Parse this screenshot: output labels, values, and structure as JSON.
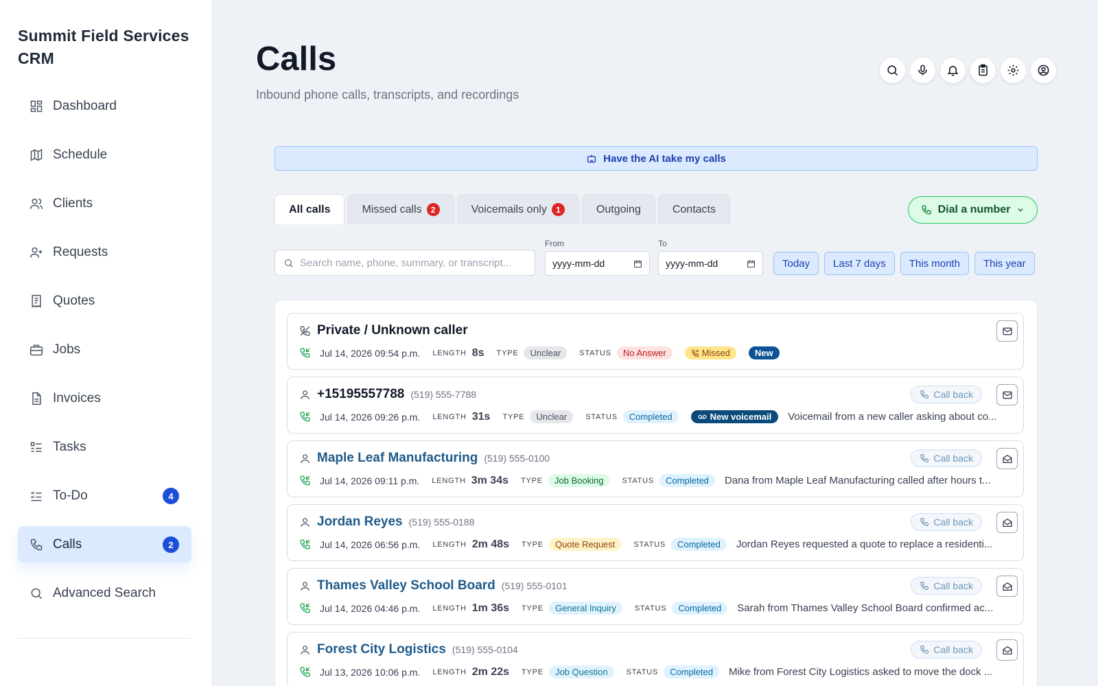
{
  "app": {
    "brand": "Summit Field Services CRM"
  },
  "sidebar": {
    "items": [
      {
        "label": "Dashboard",
        "icon": "dashboard-icon"
      },
      {
        "label": "Schedule",
        "icon": "map-icon"
      },
      {
        "label": "Clients",
        "icon": "users-icon"
      },
      {
        "label": "Requests",
        "icon": "user-plus-icon"
      },
      {
        "label": "Quotes",
        "icon": "receipt-icon"
      },
      {
        "label": "Jobs",
        "icon": "briefcase-icon"
      },
      {
        "label": "Invoices",
        "icon": "file-icon"
      },
      {
        "label": "Tasks",
        "icon": "tasks-icon"
      },
      {
        "label": "To-Do",
        "icon": "checklist-icon",
        "count": "4"
      },
      {
        "label": "Calls",
        "icon": "phone-icon",
        "count": "2",
        "active": true
      },
      {
        "label": "Advanced Search",
        "icon": "search-icon"
      }
    ]
  },
  "header": {
    "title": "Calls",
    "subtitle": "Inbound phone calls, transcripts, and recordings",
    "icons": [
      "search-icon",
      "microphone-icon",
      "bell-icon",
      "clipboard-icon",
      "gear-icon",
      "user-circle-icon"
    ]
  },
  "ai_banner": {
    "label": "Have the AI take my calls"
  },
  "tabs": [
    {
      "label": "All calls",
      "active": true
    },
    {
      "label": "Missed calls",
      "badge": "2"
    },
    {
      "label": "Voicemails only",
      "badge": "1"
    },
    {
      "label": "Outgoing"
    },
    {
      "label": "Contacts"
    }
  ],
  "dial": {
    "label": "Dial a number"
  },
  "filters": {
    "search_placeholder": "Search name, phone, summary, or transcript...",
    "from_label": "From",
    "to_label": "To",
    "date_placeholder": "yyyy-mm-dd",
    "ranges": [
      "Today",
      "Last 7 days",
      "This month",
      "This year"
    ]
  },
  "labels": {
    "length": "LENGTH",
    "type": "TYPE",
    "status": "STATUS",
    "call_back": "Call back"
  },
  "calls": [
    {
      "name": "Private / Unknown caller",
      "phone": "",
      "date": "Jul 14, 2026 09:54 p.m.",
      "length": "8s",
      "type": "Unclear",
      "status": "No Answer",
      "missed_flag": "Missed",
      "new_flag": "New",
      "summary": ""
    },
    {
      "name": "+15195557788",
      "phone": "(519) 555-7788",
      "date": "Jul 14, 2026 09:26 p.m.",
      "length": "31s",
      "type": "Unclear",
      "status": "Completed",
      "voicemail_flag": "New voicemail",
      "summary": "Voicemail from a new caller asking about co..."
    },
    {
      "name": "Maple Leaf Manufacturing",
      "phone": "(519) 555-0100",
      "date": "Jul 14, 2026 09:11 p.m.",
      "length": "3m 34s",
      "type": "Job Booking",
      "status": "Completed",
      "summary": "Dana from Maple Leaf Manufacturing called after hours t..."
    },
    {
      "name": "Jordan Reyes",
      "phone": "(519) 555-0188",
      "date": "Jul 14, 2026 06:56 p.m.",
      "length": "2m 48s",
      "type": "Quote Request",
      "status": "Completed",
      "summary": "Jordan Reyes requested a quote to replace a residenti..."
    },
    {
      "name": "Thames Valley School Board",
      "phone": "(519) 555-0101",
      "date": "Jul 14, 2026 04:46 p.m.",
      "length": "1m 36s",
      "type": "General Inquiry",
      "status": "Completed",
      "summary": "Sarah from Thames Valley School Board confirmed ac..."
    },
    {
      "name": "Forest City Logistics",
      "phone": "(519) 555-0104",
      "date": "Jul 13, 2026 10:06 p.m.",
      "length": "2m 22s",
      "type": "Job Question",
      "status": "Completed",
      "summary": "Mike from Forest City Logistics asked to move the dock ..."
    }
  ]
}
